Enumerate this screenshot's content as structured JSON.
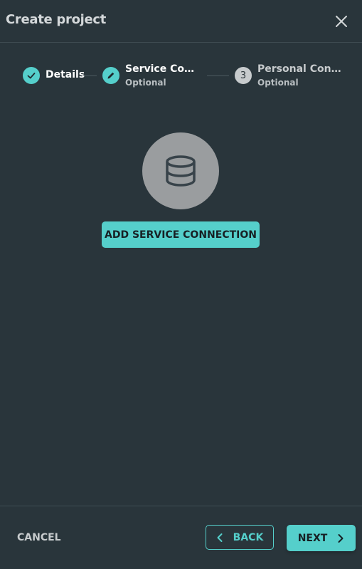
{
  "header": {
    "title": "Create project",
    "close_icon": "close-icon"
  },
  "stepper": {
    "steps": [
      {
        "label": "Details",
        "state": "completed",
        "icon": "check-icon"
      },
      {
        "label": "Service Conn…",
        "sublabel": "Optional",
        "state": "active",
        "icon": "pencil-icon"
      },
      {
        "label": "Personal Conn…",
        "sublabel": "Optional",
        "state": "pending",
        "number": "3"
      }
    ]
  },
  "main": {
    "illustration_icon": "database-icon",
    "add_button_label": "ADD SERVICE CONNECTION"
  },
  "footer": {
    "cancel_label": "CANCEL",
    "back_label": "BACK",
    "next_label": "NEXT"
  },
  "colors": {
    "background": "#29353b",
    "accent": "#55cfcb",
    "divider": "#3f4c52"
  }
}
